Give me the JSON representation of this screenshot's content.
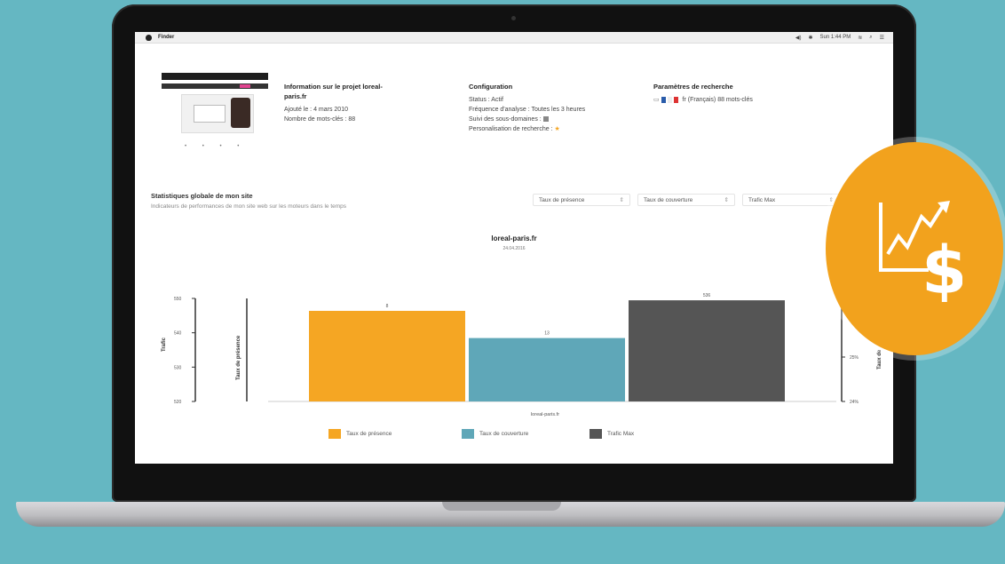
{
  "menubar": {
    "app_name": "Finder",
    "status_items": [
      "◀)",
      "✱",
      "Sun 1:44 PM",
      "≋",
      "⌕",
      "☰"
    ]
  },
  "project": {
    "title_line1": "Information sur le projet loreal-",
    "title_line2": "paris.fr",
    "added": "Ajouté le : 4 mars 2010",
    "keywords": "Nombre de mots-clés : 88"
  },
  "configuration": {
    "title": "Configuration",
    "status": "Status : Actif",
    "frequency": "Fréquence d'analyse : Toutes les 3 heures",
    "subdomains": "Suivi des sous-domaines :",
    "personalization": "Personalisation de recherche :"
  },
  "search_params": {
    "title": "Paramètres de recherche",
    "value": "fr (Français) 88 mots-clés"
  },
  "stats": {
    "title": "Statistiques globale de mon site",
    "subtitle": "Indicateurs de performances de mon site web sur les moteurs dans le temps",
    "select1": "Taux de présence",
    "select2": "Taux de couverture",
    "select3": "Trafic Max"
  },
  "chart_data": {
    "type": "bar",
    "title": "loreal-paris.fr",
    "subtitle": "24.04.2016",
    "categories": [
      "loreal-paris.fr"
    ],
    "xlabel": "loreal-paris.fr",
    "ylabel_left": "Trafic",
    "ylabel_left2": "Taux de présence",
    "ylabel_right": "Taux de",
    "left_ticks": [
      "550",
      "540",
      "530",
      "520"
    ],
    "right_ticks": [
      "25%",
      "24%"
    ],
    "series": [
      {
        "name": "Taux de présence",
        "value_label": "8",
        "relative_height": 0.6,
        "color": "#f5a623"
      },
      {
        "name": "Taux de couverture",
        "value_label": "13",
        "relative_height": 0.42,
        "color": "#5fa7b8"
      },
      {
        "name": "Trafic Max",
        "value_label": "536",
        "relative_height": 0.67,
        "color": "#555555"
      }
    ]
  },
  "colors": {
    "background": "#65b7c2",
    "accent": "#f2a21d"
  },
  "badge": {
    "icon": "chart-dollar-icon"
  }
}
